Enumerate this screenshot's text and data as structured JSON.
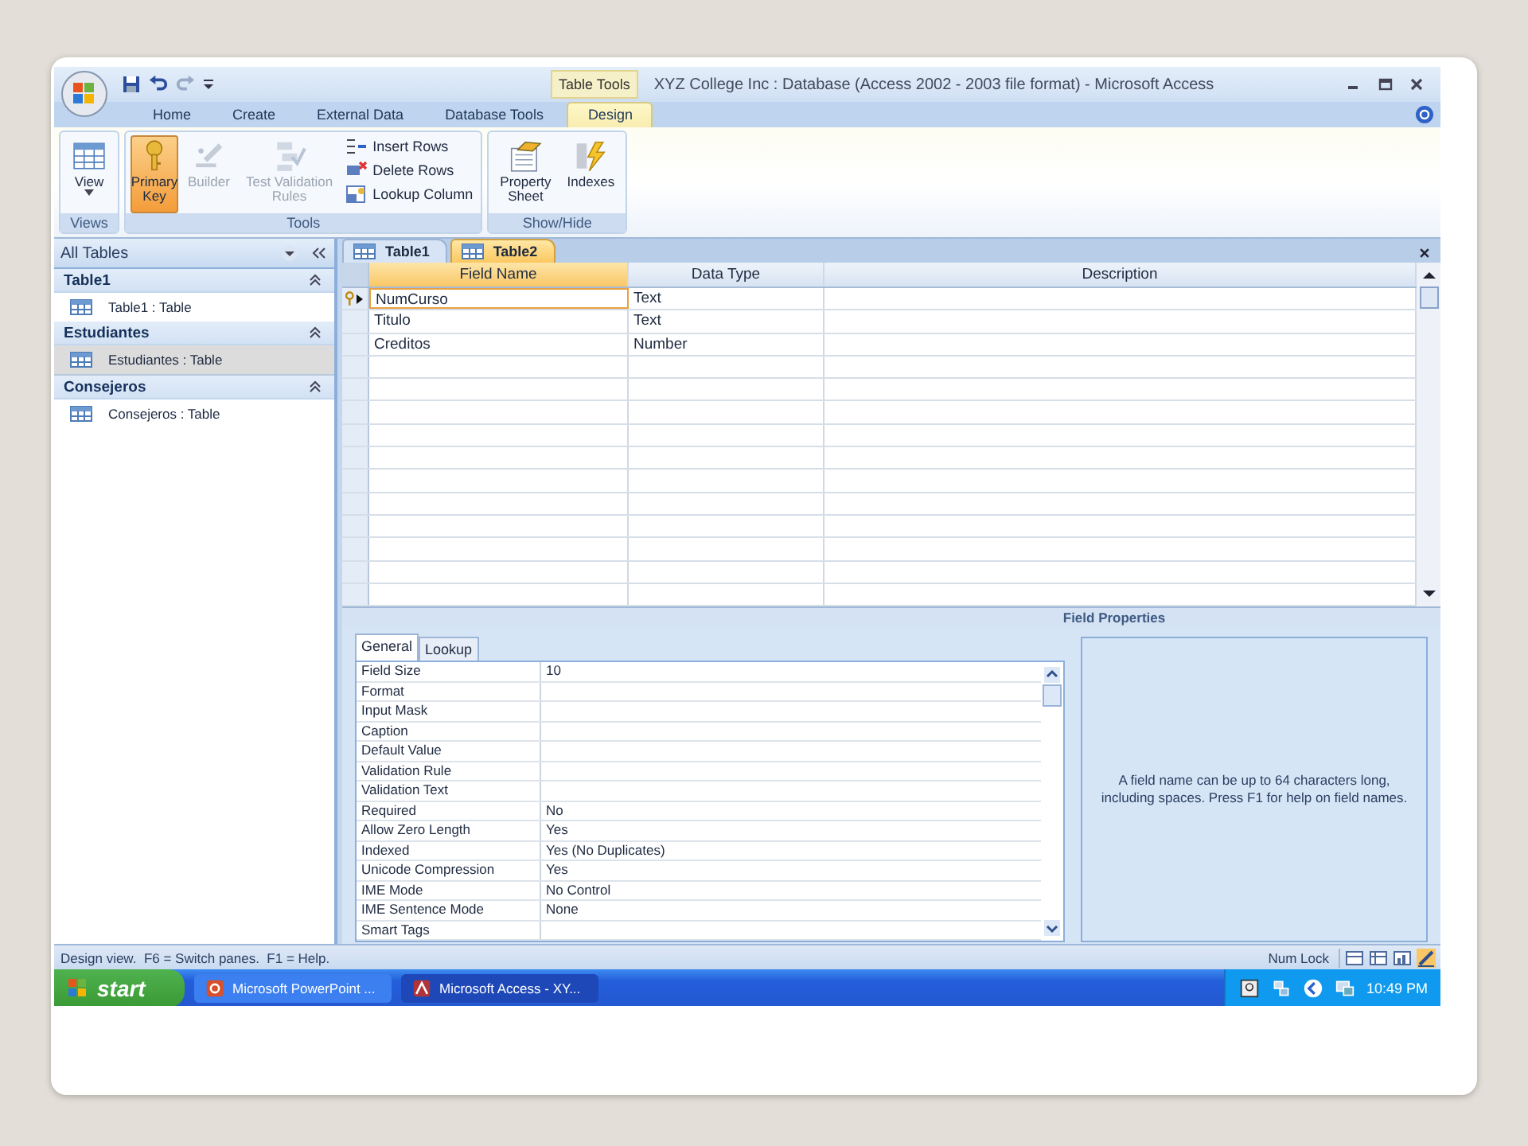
{
  "window": {
    "contextual_label": "Table Tools",
    "title": "XYZ College Inc : Database (Access 2002 - 2003 file format) - Microsoft Access"
  },
  "ribbon": {
    "tabs": [
      {
        "label": "Home",
        "selected": false
      },
      {
        "label": "Create",
        "selected": false
      },
      {
        "label": "External Data",
        "selected": false
      },
      {
        "label": "Database Tools",
        "selected": false
      },
      {
        "label": "Design",
        "selected": true
      }
    ],
    "groups": [
      {
        "label": "Views",
        "items": [
          {
            "kind": "large",
            "label": "View",
            "dropdown": true,
            "selected": false,
            "disabled": false
          }
        ]
      },
      {
        "label": "Tools",
        "items": [
          {
            "kind": "large",
            "label": "Primary\nKey",
            "selected": true,
            "disabled": false
          },
          {
            "kind": "large",
            "label": "Builder",
            "selected": false,
            "disabled": true
          },
          {
            "kind": "large",
            "label": "Test Validation\nRules",
            "selected": false,
            "disabled": true
          },
          {
            "kind": "small",
            "label": "Insert Rows"
          },
          {
            "kind": "small",
            "label": "Delete Rows"
          },
          {
            "kind": "small",
            "label": "Lookup Column"
          }
        ]
      },
      {
        "label": "Show/Hide",
        "items": [
          {
            "kind": "large",
            "label": "Property\nSheet",
            "selected": false,
            "disabled": false
          },
          {
            "kind": "large",
            "label": "Indexes",
            "selected": false,
            "disabled": false
          }
        ]
      }
    ]
  },
  "nav_pane": {
    "title": "All Tables",
    "groups": [
      {
        "title": "Table1",
        "items": [
          {
            "label": "Table1 : Table",
            "selected": false
          }
        ]
      },
      {
        "title": "Estudiantes",
        "items": [
          {
            "label": "Estudiantes : Table",
            "selected": true
          }
        ]
      },
      {
        "title": "Consejeros",
        "items": [
          {
            "label": "Consejeros : Table",
            "selected": false
          }
        ]
      }
    ]
  },
  "document_tabs": [
    {
      "label": "Table1",
      "selected": false
    },
    {
      "label": "Table2",
      "selected": true
    }
  ],
  "design_grid": {
    "columns": [
      "Field Name",
      "Data Type",
      "Description"
    ],
    "rows": [
      {
        "field_name": "NumCurso",
        "data_type": "Text",
        "primary_key": true,
        "current": true
      },
      {
        "field_name": "Titulo",
        "data_type": "Text",
        "primary_key": false,
        "current": false
      },
      {
        "field_name": "Creditos",
        "data_type": "Number",
        "primary_key": false,
        "current": false
      }
    ]
  },
  "field_properties": {
    "title": "Field Properties",
    "tabs": [
      {
        "label": "General",
        "selected": true
      },
      {
        "label": "Lookup",
        "selected": false
      }
    ],
    "properties": [
      {
        "name": "Field Size",
        "value": "10"
      },
      {
        "name": "Format"
      },
      {
        "name": "Input Mask"
      },
      {
        "name": "Caption"
      },
      {
        "name": "Default Value"
      },
      {
        "name": "Validation Rule"
      },
      {
        "name": "Validation Text"
      },
      {
        "name": "Required",
        "value": "No"
      },
      {
        "name": "Allow Zero Length",
        "value": "Yes"
      },
      {
        "name": "Indexed",
        "value": "Yes (No Duplicates)"
      },
      {
        "name": "Unicode Compression",
        "value": "Yes"
      },
      {
        "name": "IME Mode",
        "value": "No Control"
      },
      {
        "name": "IME Sentence Mode",
        "value": "None"
      },
      {
        "name": "Smart Tags"
      }
    ],
    "help_text": "A field name can be up to 64 characters long, including spaces.  Press F1 for help on field names."
  },
  "status_bar": {
    "message": "Design view.  F6 = Switch panes.  F1 = Help.",
    "indicator": "Num Lock"
  },
  "taskbar": {
    "start": "start",
    "tasks": [
      {
        "label": "Microsoft PowerPoint ...",
        "selected": false
      },
      {
        "label": "Microsoft Access - XY...",
        "selected": true
      }
    ],
    "clock": "10:49 PM"
  }
}
